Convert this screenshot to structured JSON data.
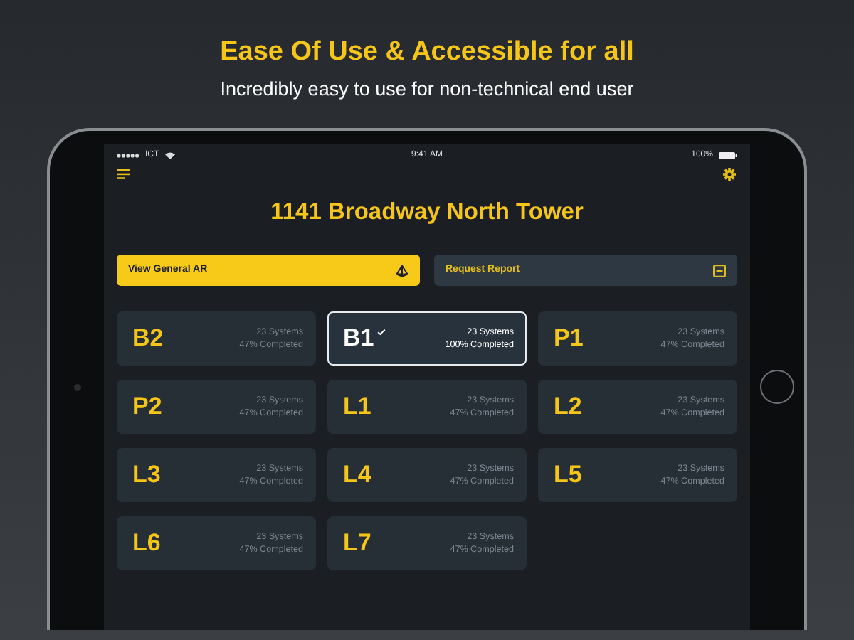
{
  "headline": "Ease Of Use & Accessible for all",
  "subheadline": "Incredibly easy to use for non-technical end user",
  "status_bar": {
    "carrier": "ICT",
    "time": "9:41 AM",
    "battery": "100%"
  },
  "title": "1141 Broadway North Tower",
  "actions": [
    {
      "label": "View General AR",
      "kind": "primary"
    },
    {
      "label": "Request Report",
      "kind": "secondary"
    }
  ],
  "levels": [
    {
      "label": "B2",
      "systems": "23 Systems",
      "completed": "47% Completed",
      "selected": false,
      "checked": false
    },
    {
      "label": "B1",
      "systems": "23 Systems",
      "completed": "100% Completed",
      "selected": true,
      "checked": true
    },
    {
      "label": "P1",
      "systems": "23 Systems",
      "completed": "47% Completed",
      "selected": false,
      "checked": false
    },
    {
      "label": "P2",
      "systems": "23 Systems",
      "completed": "47% Completed",
      "selected": false,
      "checked": false
    },
    {
      "label": "L1",
      "systems": "23 Systems",
      "completed": "47% Completed",
      "selected": false,
      "checked": false
    },
    {
      "label": "L2",
      "systems": "23 Systems",
      "completed": "47% Completed",
      "selected": false,
      "checked": false
    },
    {
      "label": "L3",
      "systems": "23 Systems",
      "completed": "47% Completed",
      "selected": false,
      "checked": false
    },
    {
      "label": "L4",
      "systems": "23 Systems",
      "completed": "47% Completed",
      "selected": false,
      "checked": false
    },
    {
      "label": "L5",
      "systems": "23 Systems",
      "completed": "47% Completed",
      "selected": false,
      "checked": false
    },
    {
      "label": "L6",
      "systems": "23 Systems",
      "completed": "47% Completed",
      "selected": false,
      "checked": false
    },
    {
      "label": "L7",
      "systems": "23 Systems",
      "completed": "47% Completed",
      "selected": false,
      "checked": false
    }
  ]
}
